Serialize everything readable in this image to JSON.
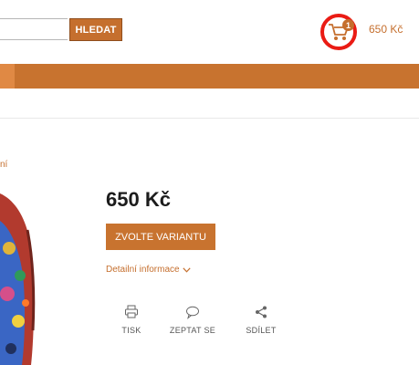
{
  "header": {
    "search": {
      "value": "",
      "placeholder": "",
      "button_label": "HLEDAT"
    },
    "cart": {
      "count": "1",
      "total": "650 Kč",
      "icon": "cart-icon"
    }
  },
  "breadcrumb": {
    "fragment": "ní"
  },
  "product": {
    "price": "650 Kč",
    "variant_button": "ZVOLTE VARIANTU",
    "details_link": "Detailní informace",
    "actions": [
      {
        "label": "TISK",
        "icon": "printer-icon"
      },
      {
        "label": "ZEPTAT SE",
        "icon": "chat-bubble-icon"
      },
      {
        "label": "SDÍLET",
        "icon": "share-icon"
      }
    ]
  },
  "colors": {
    "accent": "#c8732f",
    "highlight": "#ea1b14",
    "text": "#1c1c1c"
  }
}
